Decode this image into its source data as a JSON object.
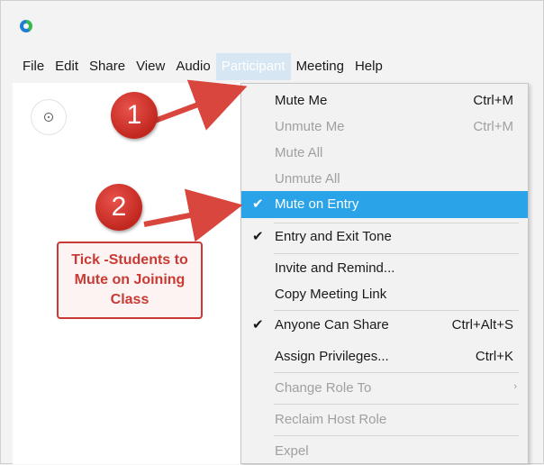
{
  "menubar": {
    "items": [
      {
        "label": "File",
        "active": false
      },
      {
        "label": "Edit",
        "active": false
      },
      {
        "label": "Share",
        "active": false
      },
      {
        "label": "View",
        "active": false
      },
      {
        "label": "Audio",
        "active": false
      },
      {
        "label": "Participant",
        "active": true
      },
      {
        "label": "Meeting",
        "active": false
      },
      {
        "label": "Help",
        "active": false
      }
    ]
  },
  "dropdown": {
    "items": [
      {
        "label": "Mute Me",
        "shortcut": "Ctrl+M",
        "disabled": false,
        "checked": false,
        "highlight": false
      },
      {
        "label": "Unmute Me",
        "shortcut": "Ctrl+M",
        "disabled": true,
        "checked": false,
        "highlight": false
      },
      {
        "label": "Mute All",
        "shortcut": "",
        "disabled": true,
        "checked": false,
        "highlight": false
      },
      {
        "label": "Unmute All",
        "shortcut": "",
        "disabled": true,
        "checked": false,
        "highlight": false
      },
      {
        "label": "Mute on Entry",
        "shortcut": "",
        "disabled": false,
        "checked": true,
        "highlight": true
      },
      {
        "label": "Entry and Exit Tone",
        "shortcut": "",
        "disabled": false,
        "checked": true,
        "highlight": false
      },
      {
        "label": "Invite and Remind...",
        "shortcut": "",
        "disabled": false,
        "checked": false,
        "highlight": false
      },
      {
        "label": "Copy Meeting Link",
        "shortcut": "",
        "disabled": false,
        "checked": false,
        "highlight": false
      },
      {
        "label": "Anyone Can Share",
        "shortcut": "Ctrl+Alt+S",
        "disabled": false,
        "checked": true,
        "highlight": false
      },
      {
        "label": "Assign Privileges...",
        "shortcut": "Ctrl+K",
        "disabled": false,
        "checked": false,
        "highlight": false
      },
      {
        "label": "Change Role To",
        "shortcut": "",
        "disabled": true,
        "checked": false,
        "highlight": false,
        "submenu": true
      },
      {
        "label": "Reclaim Host Role",
        "shortcut": "",
        "disabled": true,
        "checked": false,
        "highlight": false
      },
      {
        "label": "Expel",
        "shortcut": "",
        "disabled": true,
        "checked": false,
        "highlight": false
      }
    ]
  },
  "annotations": {
    "badge_1": "1",
    "badge_2": "2",
    "callout": "Tick -Students to Mute on Joining Class",
    "color": "#c83a33"
  },
  "glyphs": {
    "check": "✔",
    "submenu_arrow": "›"
  },
  "colors": {
    "highlight": "#2aa3e8",
    "menu_active": "#d6e6f2",
    "disabled_text": "#a0a0a0"
  }
}
